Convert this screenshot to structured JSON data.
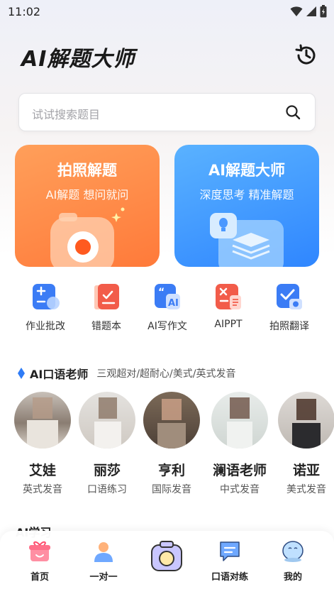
{
  "status_bar": {
    "time": "11:02"
  },
  "header": {
    "title": "AI解题大师"
  },
  "search": {
    "placeholder": "试试搜索题目"
  },
  "cards": [
    {
      "title": "拍照解题",
      "subtitle": "AI解题  想问就问",
      "color": "#ff8a45"
    },
    {
      "title": "AI解题大师",
      "subtitle": "深度思考  精准解题",
      "color": "#3d93ff"
    }
  ],
  "tools": [
    {
      "label": "作业批改",
      "icon": "homework-check-icon"
    },
    {
      "label": "错题本",
      "icon": "wrong-notebook-icon"
    },
    {
      "label": "AI写作文",
      "icon": "ai-essay-icon"
    },
    {
      "label": "AIPPT",
      "icon": "ai-ppt-icon"
    },
    {
      "label": "拍照翻译",
      "icon": "photo-translate-icon"
    }
  ],
  "teacher_section": {
    "title": "AI口语老师",
    "subtitle": "三观超对/超耐心/美式/英式发音",
    "teachers": [
      {
        "name": "艾娃",
        "desc": "英式发音"
      },
      {
        "name": "丽莎",
        "desc": "口语练习"
      },
      {
        "name": "亨利",
        "desc": "国际发音"
      },
      {
        "name": "澜语老师",
        "desc": "中式发音"
      },
      {
        "name": "诺亚",
        "desc": "美式发音"
      }
    ]
  },
  "next_section": {
    "title": "AI学习"
  },
  "tabbar": {
    "items": [
      {
        "label": "首页",
        "icon": "home-gift-icon"
      },
      {
        "label": "一对一",
        "icon": "person-icon"
      },
      {
        "label": "",
        "icon": "camera-icon"
      },
      {
        "label": "口语对练",
        "icon": "chat-icon"
      },
      {
        "label": "我的",
        "icon": "profile-icon"
      }
    ]
  },
  "colors": {
    "accent_orange": "#ff8a45",
    "accent_blue": "#3d93ff",
    "tool_blue": "#3b7cf5",
    "tool_red": "#f25c4a"
  }
}
